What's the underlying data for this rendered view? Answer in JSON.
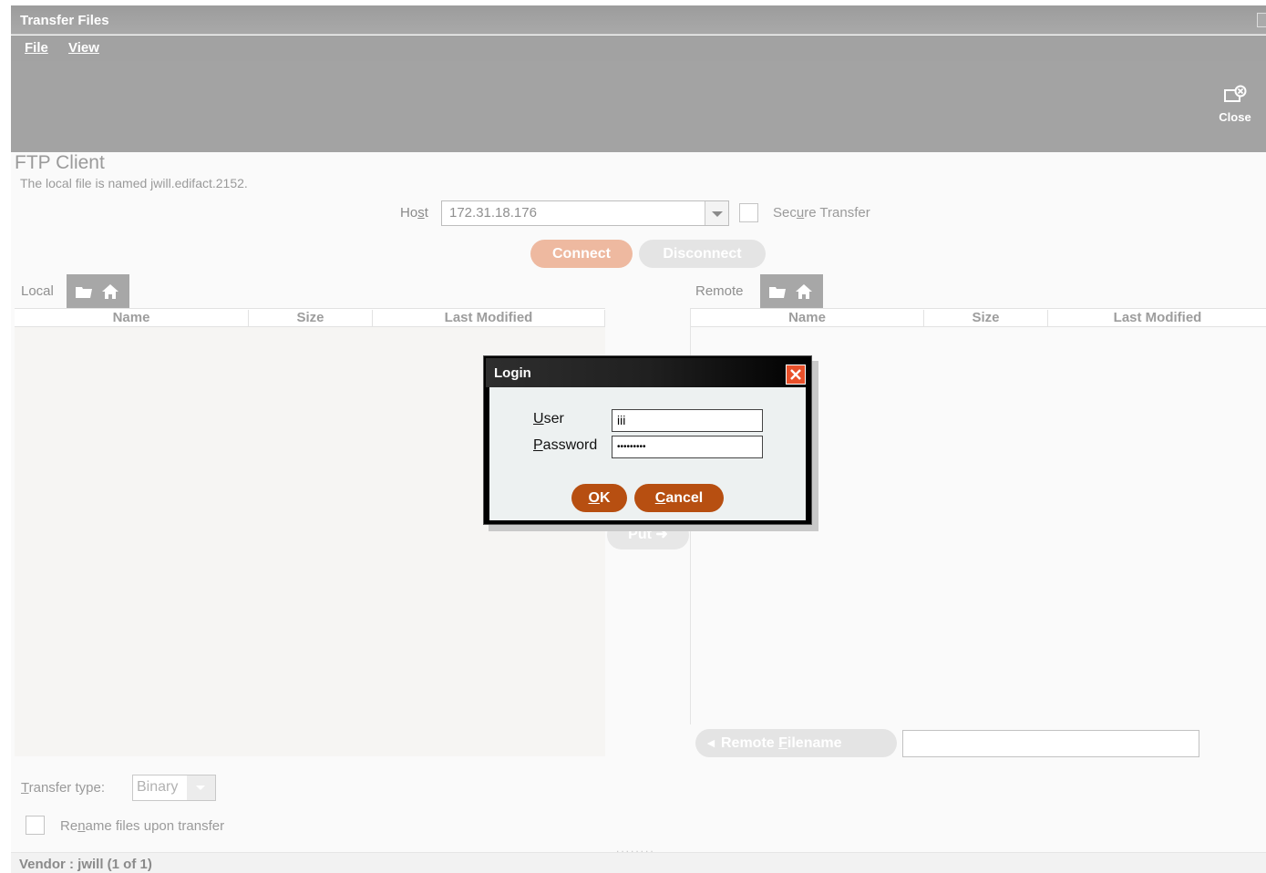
{
  "window": {
    "title": "Transfer Files"
  },
  "menu": {
    "file": "File",
    "view": "View"
  },
  "toolbar": {
    "close_label": "Close"
  },
  "page": {
    "title": "FTP Client",
    "subtitle": "The local file is named jwill.edifact.2152."
  },
  "connection": {
    "host_label_pre": "Ho",
    "host_label_mn": "s",
    "host_label_post": "t",
    "host_value": "172.31.18.176",
    "secure_pre": "Sec",
    "secure_mn": "u",
    "secure_post": "re Transfer",
    "secure_checked": false,
    "connect_label": "Connect",
    "disconnect_label": "Disconnect"
  },
  "local": {
    "label": "Local",
    "columns": [
      "Name",
      "Size",
      "Last Modified"
    ]
  },
  "remote": {
    "label": "Remote",
    "columns": [
      "Name",
      "Size",
      "Last Modified"
    ],
    "filename_btn_pre": "Remote ",
    "filename_btn_mn": "F",
    "filename_btn_post": "ilename",
    "filename_value": ""
  },
  "put_label": "Put",
  "transfer": {
    "type_label_mn": "T",
    "type_label_rest": "ransfer type:",
    "type_value": "Binary",
    "rename_pre": "Re",
    "rename_mn": "n",
    "rename_post": "ame files upon transfer",
    "rename_checked": false
  },
  "status": {
    "text": "Vendor : jwill (1 of 1)"
  },
  "login": {
    "title": "Login",
    "user_mn": "U",
    "user_rest": "ser",
    "user_value": "iii",
    "password_mn": "P",
    "password_rest": "assword",
    "password_value": "•••••••••",
    "ok_mn": "O",
    "ok_rest": "K",
    "cancel_mn": "C",
    "cancel_rest": "ancel"
  },
  "colors": {
    "accent": "#b74f11",
    "accent_disabled": "#eeb9a0",
    "chrome": "#a3a3a3",
    "dialog_close": "#e9502a"
  },
  "icons": [
    "close-window-icon",
    "open-folder-icon",
    "home-icon",
    "arrow-left-icon",
    "arrow-right-icon",
    "dialog-close-icon"
  ]
}
